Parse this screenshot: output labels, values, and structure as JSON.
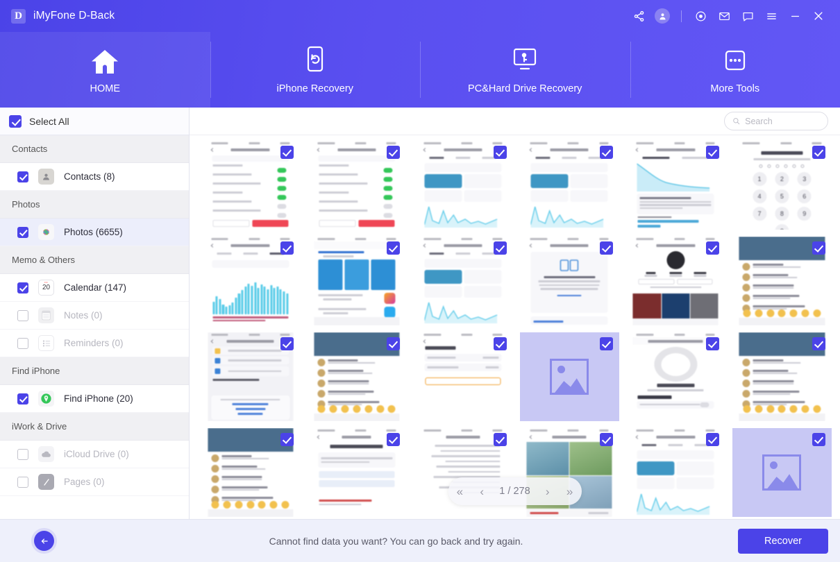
{
  "window": {
    "app_title": "iMyFone D-Back",
    "logo_letter": "D",
    "controls": {
      "share": "share-icon",
      "account": "account-icon",
      "target": "target-icon",
      "mail": "mail-icon",
      "chat": "chat-icon",
      "menu": "menu-icon",
      "minimize": "minimize-icon",
      "close": "close-icon"
    }
  },
  "nav": {
    "tabs": [
      {
        "label": "HOME",
        "icon": "home-icon",
        "active": true
      },
      {
        "label": "iPhone Recovery",
        "icon": "phone-refresh-icon",
        "active": false
      },
      {
        "label": "PC&Hard Drive Recovery",
        "icon": "monitor-key-icon",
        "active": false
      },
      {
        "label": "More Tools",
        "icon": "more-dots-icon",
        "active": false
      }
    ]
  },
  "sidebar": {
    "select_all_label": "Select All",
    "select_all_checked": true,
    "groups": [
      {
        "title": "Contacts",
        "items": [
          {
            "label": "Contacts (8)",
            "checked": true,
            "enabled": true,
            "icon": "contacts-app-icon",
            "selected": false
          }
        ]
      },
      {
        "title": "Photos",
        "items": [
          {
            "label": "Photos (6655)",
            "checked": true,
            "enabled": true,
            "icon": "photos-app-icon",
            "selected": true
          }
        ]
      },
      {
        "title": "Memo & Others",
        "items": [
          {
            "label": "Calendar (147)",
            "checked": true,
            "enabled": true,
            "icon": "calendar-app-icon",
            "selected": false
          },
          {
            "label": "Notes (0)",
            "checked": false,
            "enabled": false,
            "icon": "notes-app-icon",
            "selected": false
          },
          {
            "label": "Reminders (0)",
            "checked": false,
            "enabled": false,
            "icon": "reminders-app-icon",
            "selected": false
          }
        ]
      },
      {
        "title": "Find iPhone",
        "items": [
          {
            "label": "Find iPhone (20)",
            "checked": true,
            "enabled": true,
            "icon": "find-iphone-app-icon",
            "selected": false
          }
        ]
      },
      {
        "title": "iWork & Drive",
        "items": [
          {
            "label": "iCloud Drive (0)",
            "checked": false,
            "enabled": false,
            "icon": "icloud-drive-app-icon",
            "selected": false
          },
          {
            "label": "Pages (0)",
            "checked": false,
            "enabled": false,
            "icon": "pages-app-icon",
            "selected": false
          }
        ]
      }
    ]
  },
  "search": {
    "placeholder": "Search",
    "value": ""
  },
  "gallery": {
    "thumbnails": [
      {
        "kind": "settings-toggles",
        "checked": true,
        "title": "Publicar"
      },
      {
        "kind": "settings-toggles",
        "checked": true,
        "title": "Más opciones"
      },
      {
        "kind": "analytics-line",
        "checked": true,
        "title": "Estadísticas"
      },
      {
        "kind": "analytics-line",
        "checked": true,
        "title": "Estadísticas"
      },
      {
        "kind": "analytics-area",
        "checked": true,
        "title": "Análisis del vídeo"
      },
      {
        "kind": "keypad",
        "checked": true,
        "title": "依你还记得嗎？"
      },
      {
        "kind": "analytics-bar",
        "checked": true,
        "title": "Estadísticas"
      },
      {
        "kind": "appstore",
        "checked": true,
        "title": "Telegram Messenger"
      },
      {
        "kind": "analytics-line",
        "checked": true,
        "title": "Estadísticas"
      },
      {
        "kind": "transfer-dialog",
        "checked": true,
        "title": "iPhone Übertragen/Zurücksetzen"
      },
      {
        "kind": "profile-grid",
        "checked": true,
        "title": "WhatsAppTec"
      },
      {
        "kind": "chat-feed",
        "checked": true,
        "title": "Chat"
      },
      {
        "kind": "chat-dialog",
        "checked": true,
        "title": "+86 180 0886 0468"
      },
      {
        "kind": "chat-feed",
        "checked": true,
        "title": "Feed"
      },
      {
        "kind": "backup-screen",
        "checked": true,
        "title": "iPhone (3)"
      },
      {
        "kind": "placeholder",
        "checked": true,
        "title": ""
      },
      {
        "kind": "sleep-dial",
        "checked": true,
        "title": "Nur nächste Aufwach..."
      },
      {
        "kind": "chat-feed",
        "checked": true,
        "title": "Feed"
      },
      {
        "kind": "chat-feed",
        "checked": true,
        "title": "Feed"
      },
      {
        "kind": "appleid-screen",
        "checked": true,
        "title": "Apple ID"
      },
      {
        "kind": "arabic-text",
        "checked": true,
        "title": ""
      },
      {
        "kind": "photo-map",
        "checked": true,
        "title": "Recientes"
      },
      {
        "kind": "analytics-line",
        "checked": true,
        "title": "Estadísticas"
      },
      {
        "kind": "placeholder",
        "checked": true,
        "title": ""
      }
    ],
    "pagination": {
      "first_label": "«",
      "prev_label": "‹",
      "next_label": "›",
      "last_label": "»",
      "current_page": 1,
      "total_pages": 278,
      "display": "1 / 278"
    }
  },
  "footer": {
    "message": "Cannot find data you want? You can go back and try again.",
    "back_icon": "arrow-left-icon",
    "recover_label": "Recover"
  },
  "colors": {
    "brand_purple": "#4b43e8",
    "header_gradient_start": "#4b43e8",
    "header_gradient_end": "#6257f5",
    "footer_bg": "#eef0fb",
    "selected_row_bg": "#eceefb",
    "placeholder_bg": "#c8c8f4"
  }
}
